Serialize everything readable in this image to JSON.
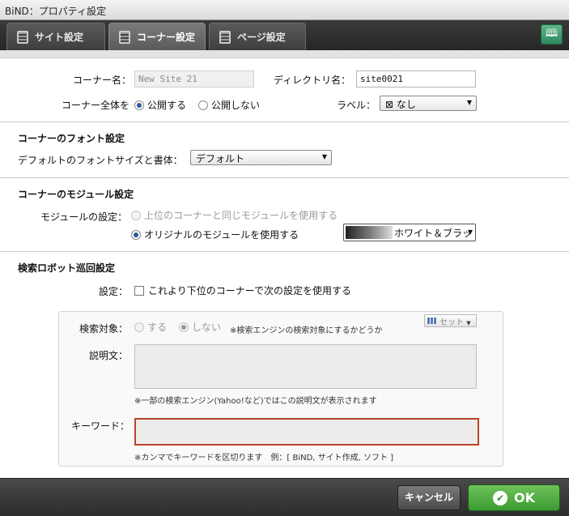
{
  "window": {
    "title": "BiND：プロパティ設定"
  },
  "tabs": [
    {
      "label": "サイト設定"
    },
    {
      "label": "コーナー設定"
    },
    {
      "label": "ページ設定"
    }
  ],
  "corner": {
    "name_label": "コーナー名：",
    "name_value": "New Site 21",
    "dir_label": "ディレクトリ名：",
    "dir_value": "site0021",
    "whole_label": "コーナー全体を",
    "publish": "公開する",
    "unpublish": "公開しない",
    "label_label": "ラベル：",
    "label_value": "なし"
  },
  "font_section": {
    "heading": "コーナーのフォント設定",
    "size_label": "デフォルトのフォントサイズと書体：",
    "size_value": "デフォルト"
  },
  "module_section": {
    "heading": "コーナーのモジュール設定",
    "setting_label": "モジュールの設定：",
    "option_parent": "上位のコーナーと同じモジュールを使用する",
    "option_original": "オリジナルのモジュールを使用する",
    "style_value": "ホワイト＆ブラッ"
  },
  "robot_section": {
    "heading": "検索ロボット巡回設定",
    "setting_label": "設定：",
    "checkbox_label": "これより下位のコーナーで次の設定を使用する",
    "target_label": "検索対象：",
    "yes": "する",
    "no": "しない",
    "target_note": "※検索エンジンの検索対象にするかどうか",
    "set_button": "セット",
    "desc_label": "説明文：",
    "desc_note": "※一部の検索エンジン(Yahoo!など)ではこの説明文が表示されます",
    "keyword_label": "キーワード：",
    "keyword_note": "※カンマでキーワードを区切ります　例：[ BiND, サイト作成, ソフト ]"
  },
  "footer": {
    "cancel": "キャンセル",
    "ok": "OK"
  }
}
